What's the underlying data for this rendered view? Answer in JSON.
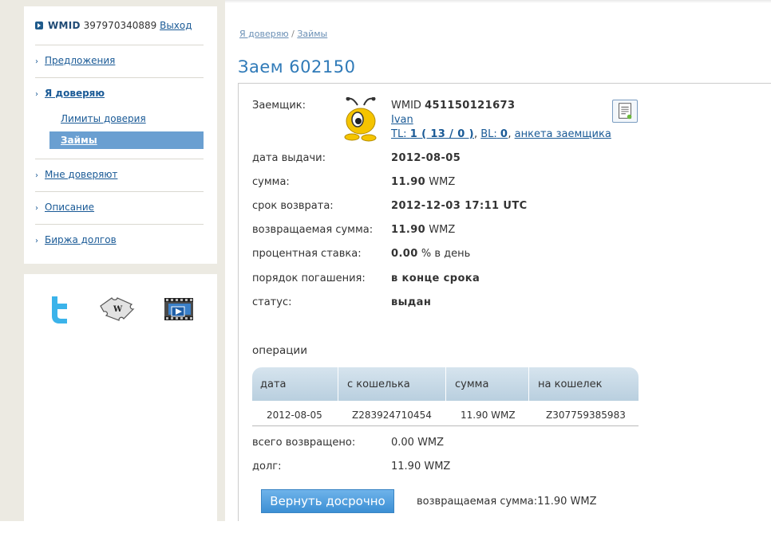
{
  "user": {
    "wmid_label": "WMID",
    "wmid": "397970340889",
    "logout": "Выход"
  },
  "sidebar": {
    "items": [
      {
        "label": "Предложения"
      },
      {
        "label": "Я доверяю"
      },
      {
        "label": "Мне доверяют"
      },
      {
        "label": "Описание"
      },
      {
        "label": "Биржа долгов"
      }
    ],
    "subitems": [
      {
        "label": "Лимиты доверия"
      },
      {
        "label": "Займы"
      }
    ]
  },
  "social_icons": [
    "twitter-icon",
    "wiki-puzzle-icon",
    "video-icon"
  ],
  "breadcrumb": {
    "root": "Я доверяю",
    "sep": "/",
    "current": "Займы"
  },
  "page": {
    "title": "Заем 602150"
  },
  "loan": {
    "borrower_label": "Заемщик:",
    "borrower_wmid_label": "WMID",
    "borrower_wmid": "451150121673",
    "borrower_name": "Ivan",
    "tl_label": "TL:",
    "tl_value": "1 ( 13 / 0 )",
    "bl_label": "BL:",
    "bl_value": "0",
    "profile_link": "анкета заемщика",
    "issue_date_label": "дата выдачи:",
    "issue_date": "2012-08-05",
    "amount_label": "сумма:",
    "amount": "11.90",
    "amount_currency": "WMZ",
    "due_label": "срок возврата:",
    "due": "2012-12-03 17:11 UTC",
    "return_amount_label": "возвращаемая сумма:",
    "return_amount": "11.90",
    "return_currency": "WMZ",
    "rate_label": "процентная ставка:",
    "rate": "0.00",
    "rate_unit": "% в день",
    "repay_order_label": "порядок погашения:",
    "repay_order": "в конце срока",
    "status_label": "статус:",
    "status": "выдан"
  },
  "operations": {
    "title": "операции",
    "columns": [
      "дата",
      "с кошелька",
      "сумма",
      "на кошелек"
    ],
    "rows": [
      {
        "date": "2012-08-05",
        "from": "Z283924710454",
        "amount": "11.90 WMZ",
        "to": "Z307759385983"
      }
    ]
  },
  "totals": {
    "returned_label": "всего возвращено:",
    "returned": "0.00 WMZ",
    "debt_label": "долг:",
    "debt": "11.90 WMZ"
  },
  "actions": {
    "return_early": "Вернуть досрочно",
    "return_sum_label": "возвращаемая сумма:",
    "return_sum": "11.90 WMZ"
  },
  "colors": {
    "accent": "#2f7ab8",
    "active_menu": "#6a9fd1",
    "button": "#4a9be0"
  }
}
